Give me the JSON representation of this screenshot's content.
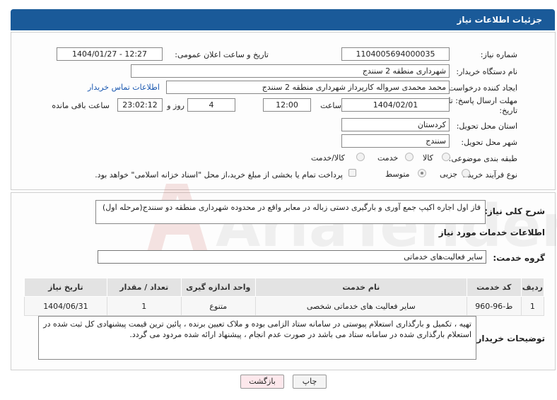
{
  "header": {
    "title": "جزئیات اطلاعات نیاز"
  },
  "fields": {
    "need_number_label": "شماره نیاز:",
    "need_number": "1104005694000035",
    "announce_label": "تاریخ و ساعت اعلان عمومی:",
    "announce_value": "1404/01/27 - 12:27",
    "buyer_org_label": "نام دستگاه خریدار:",
    "buyer_org": "شهرداری منطقه 2 سنندج",
    "requester_label": "ایجاد کننده درخواست:",
    "requester": "محمد محمدی سرواله کارپرداز شهرداری منطقه 2 سنندج",
    "contact_link": "اطلاعات تماس خریدار",
    "deadline_label": "مهلت ارسال پاسخ: تا تاریخ:",
    "deadline_date": "1404/02/01",
    "time_label": "ساعت",
    "deadline_time": "12:00",
    "days_value": "4",
    "days_label": "روز و",
    "remaining_time": "23:02:12",
    "remaining_label": "ساعت باقی مانده",
    "province_label": "استان محل تحویل:",
    "province": "کردستان",
    "city_label": "شهر محل تحویل:",
    "city": "سنندج",
    "category_label": "طبقه بندی موضوعی:",
    "category_options": [
      "کالا",
      "خدمت",
      "کالا/خدمت"
    ],
    "process_label": "نوع فرآیند خرید :",
    "process_options": [
      "جزیی",
      "متوسط"
    ],
    "payment_note": "پرداخت تمام یا بخشی از مبلغ خرید،از محل \"اسناد خزانه اسلامی\" خواهد بود."
  },
  "summary": {
    "label": "شرح کلی نیاز:",
    "text": "فاز اول اجاره اکیپ جمع آوری و بارگیری دستی زباله در معابر واقع در محدوده شهرداری منطقه دو سنندج(مرحله اول)"
  },
  "services": {
    "section_title": "اطلاعات خدمات مورد نیاز",
    "group_label": "گروه خدمت:",
    "group_value": "سایر فعالیت‌های خدماتی",
    "columns": [
      "ردیف",
      "کد خدمت",
      "نام خدمت",
      "واحد اندازه گیری",
      "تعداد / مقدار",
      "تاریخ نیاز"
    ],
    "rows": [
      [
        "1",
        "ط-96-960",
        "سایر فعالیت های خدماتی شخصی",
        "متنوع",
        "1",
        "1404/06/31"
      ]
    ]
  },
  "buyer_notes": {
    "label": "توضیحات خریدار:",
    "text": "تهیه ، تکمیل و بارگذاری استعلام پیوستی در سامانه ستاد الزامی بوده و ملاک تعیین برنده ، پائین ترین قیمت پیشنهادی کل ثبت شده در استعلام بارگذاری شده در سامانه ستاد می باشد در صورت عدم انجام ، پیشنهاد ارائه شده مردود می گردد."
  },
  "buttons": {
    "print": "چاپ",
    "back": "بازگشت"
  },
  "watermark": "AriaTender.neT",
  "colors": {
    "header_bg": "#1a5a99",
    "link": "#1a58b0",
    "back_btn_bg": "#fde8ec",
    "watermark": "#c0392b"
  }
}
